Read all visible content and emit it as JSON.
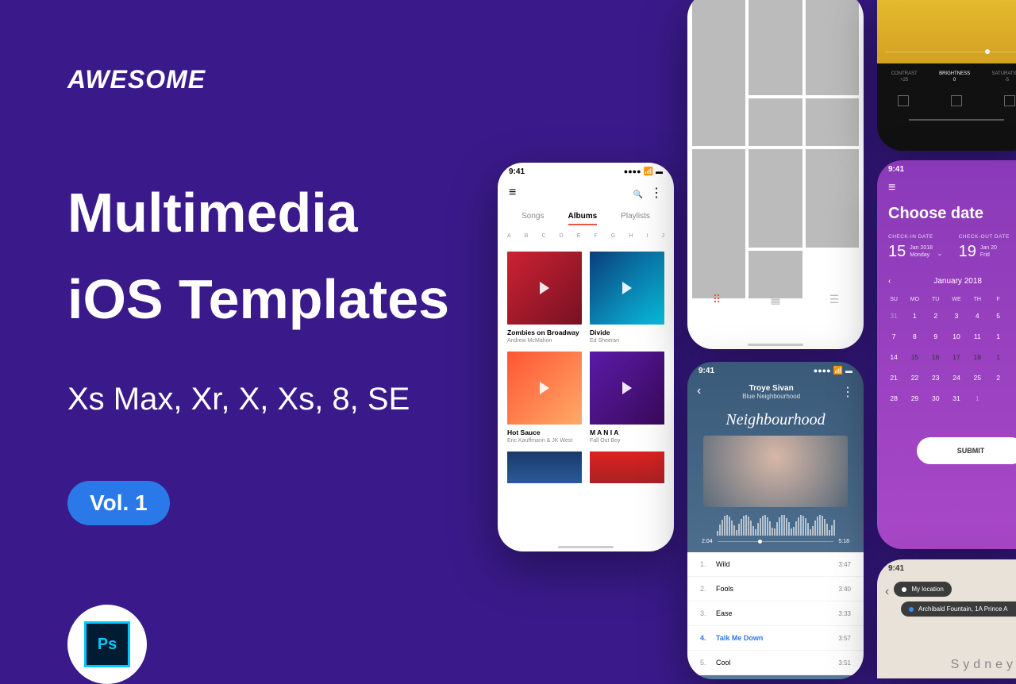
{
  "brand": "AWESOME",
  "headline_1": "Multimedia",
  "headline_2": "iOS Templates",
  "subhead": "Xs Max, Xr, X, Xs, 8, SE",
  "badge": "Vol. 1",
  "ps_label": "Ps",
  "status_time": "9:41",
  "phone1": {
    "tabs": [
      "Songs",
      "Albums",
      "Playlists"
    ],
    "active_tab": 1,
    "letters": [
      "A",
      "B",
      "C",
      "D",
      "E",
      "F",
      "G",
      "H",
      "I",
      "J"
    ],
    "albums": [
      {
        "title": "Zombies on Broadway",
        "artist": "Andrew McMahon"
      },
      {
        "title": "Divide",
        "artist": "Ed Sheeran"
      },
      {
        "title": "Hot Sauce",
        "artist": "Eric Kauffmann & JK West"
      },
      {
        "title": "M A N I A",
        "artist": "Fall Out Boy"
      }
    ]
  },
  "phone3": {
    "artist": "Troye Sivan",
    "album": "Blue Neighbourhood",
    "script": "Neighbourhood",
    "pos": "2:04",
    "dur": "5:18",
    "tracks": [
      {
        "n": "1.",
        "name": "Wild",
        "dur": "3:47"
      },
      {
        "n": "2.",
        "name": "Fools",
        "dur": "3:40"
      },
      {
        "n": "3.",
        "name": "Ease",
        "dur": "3:33"
      },
      {
        "n": "4.",
        "name": "Talk Me Down",
        "dur": "3:57",
        "active": true
      },
      {
        "n": "5.",
        "name": "Cool",
        "dur": "3:51"
      }
    ]
  },
  "phone4": {
    "items": [
      {
        "l": "CONTRAST",
        "v": "+25"
      },
      {
        "l": "BRIGHTNESS",
        "v": "0",
        "active": true
      },
      {
        "l": "SATURATION",
        "v": "-5"
      }
    ]
  },
  "phone5": {
    "title": "Choose date",
    "checkin": {
      "label": "CHECK-IN DATE",
      "day": "15",
      "m": "Jan 2018",
      "w": "Monday"
    },
    "checkout": {
      "label": "CHECK-OUT DATE",
      "day": "19",
      "m": "Jan 20",
      "w": "Frid"
    },
    "month": "January 2018",
    "dow": [
      "SU",
      "MO",
      "TU",
      "WE",
      "TH",
      "F"
    ],
    "weeks": [
      [
        {
          "d": "31",
          "mute": true
        },
        {
          "d": "1"
        },
        {
          "d": "2"
        },
        {
          "d": "3"
        },
        {
          "d": "4"
        },
        {
          "d": "5"
        }
      ],
      [
        {
          "d": "7"
        },
        {
          "d": "8"
        },
        {
          "d": "9"
        },
        {
          "d": "10"
        },
        {
          "d": "11"
        },
        {
          "d": "1"
        }
      ],
      [
        {
          "d": "14"
        },
        {
          "d": "15",
          "sel": "l"
        },
        {
          "d": "16",
          "sel": "m"
        },
        {
          "d": "17",
          "sel": "m"
        },
        {
          "d": "18",
          "sel": "m"
        },
        {
          "d": "1",
          "sel": "r"
        }
      ],
      [
        {
          "d": "21"
        },
        {
          "d": "22"
        },
        {
          "d": "23"
        },
        {
          "d": "24"
        },
        {
          "d": "25"
        },
        {
          "d": "2"
        }
      ],
      [
        {
          "d": "28"
        },
        {
          "d": "29"
        },
        {
          "d": "30"
        },
        {
          "d": "31"
        },
        {
          "d": "1",
          "mute": true
        },
        {
          "d": ""
        }
      ]
    ],
    "submit": "SUBMIT"
  },
  "phone6": {
    "chip1": "My location",
    "chip2": "Archibald Fountain, 1A Prince A",
    "city": "Sydney"
  }
}
